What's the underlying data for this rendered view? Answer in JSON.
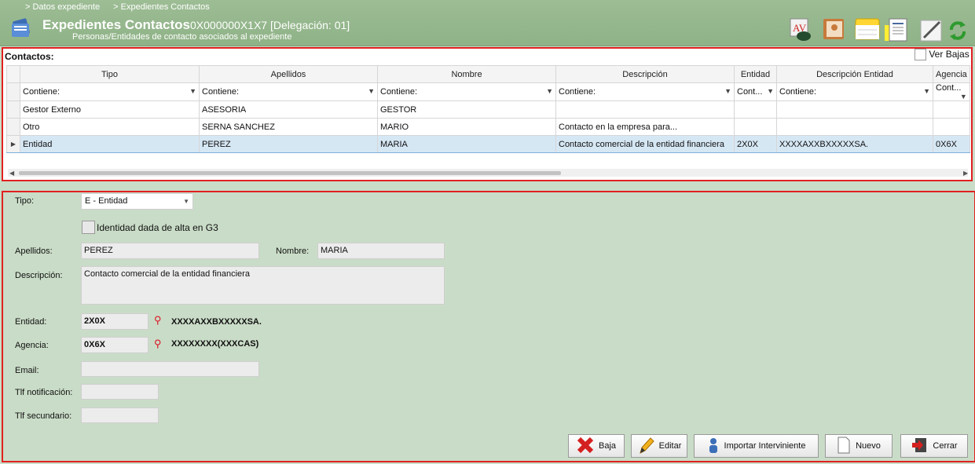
{
  "breadcrumb": [
    "> Datos expediente",
    "> Expedientes Contactos"
  ],
  "header": {
    "title": "Expedientes Contactos",
    "expediente": "0X000000X1X7 [Delegación: 01]",
    "subtitle": "Personas/Entidades de contacto asociados al expediente"
  },
  "toolbar_icons": [
    "signature-cloud-icon",
    "address-book-icon",
    "notes-icon",
    "document-icon",
    "edit-pen-icon",
    "refresh-icon"
  ],
  "grid": {
    "label": "Contactos:",
    "ver_bajas": "Ver Bajas",
    "columns": [
      "Tipo",
      "Apellidos",
      "Nombre",
      "Descripción",
      "Entidad",
      "Descripción Entidad",
      "Agencia"
    ],
    "filters": [
      "Contiene:",
      "Contiene:",
      "Contiene:",
      "Contiene:",
      "Cont...",
      "Contiene:",
      "Cont..."
    ],
    "rows": [
      [
        "Gestor Externo",
        "ASESORIA",
        "GESTOR",
        "",
        "",
        "",
        ""
      ],
      [
        "Otro",
        "SERNA SANCHEZ",
        "MARIO",
        "Contacto en la empresa para...",
        "",
        "",
        ""
      ],
      [
        "Entidad",
        "PEREZ",
        "MARIA",
        "Contacto comercial de la entidad financiera",
        "2X0X",
        "XXXXAXXBXXXXXSA.",
        "0X6X"
      ]
    ],
    "selected_row": 2
  },
  "form": {
    "tipo_label": "Tipo:",
    "tipo_value": "E - Entidad",
    "alta_label": "Identidad dada de alta en G3",
    "apellidos_label": "Apellidos:",
    "apellidos_value": "PEREZ",
    "nombre_label": "Nombre:",
    "nombre_value": "MARIA",
    "descripcion_label": "Descripción:",
    "descripcion_value": "Contacto comercial de la entidad financiera",
    "entidad_label": "Entidad:",
    "entidad_code": "2X0X",
    "entidad_desc": "XXXXAXXBXXXXXSA.",
    "agencia_label": "Agencia:",
    "agencia_code": "0X6X",
    "agencia_desc": "XXXXXXXX(XXXCAS)",
    "email_label": "Email:",
    "email_value": "",
    "tlf_notif_label": "Tlf notificación:",
    "tlf_notif_value": "",
    "tlf_sec_label": "Tlf secundario:",
    "tlf_sec_value": ""
  },
  "buttons": {
    "baja": "Baja",
    "editar": "Editar",
    "importar": "Importar Interviniente",
    "nuevo": "Nuevo",
    "cerrar": "Cerrar"
  }
}
